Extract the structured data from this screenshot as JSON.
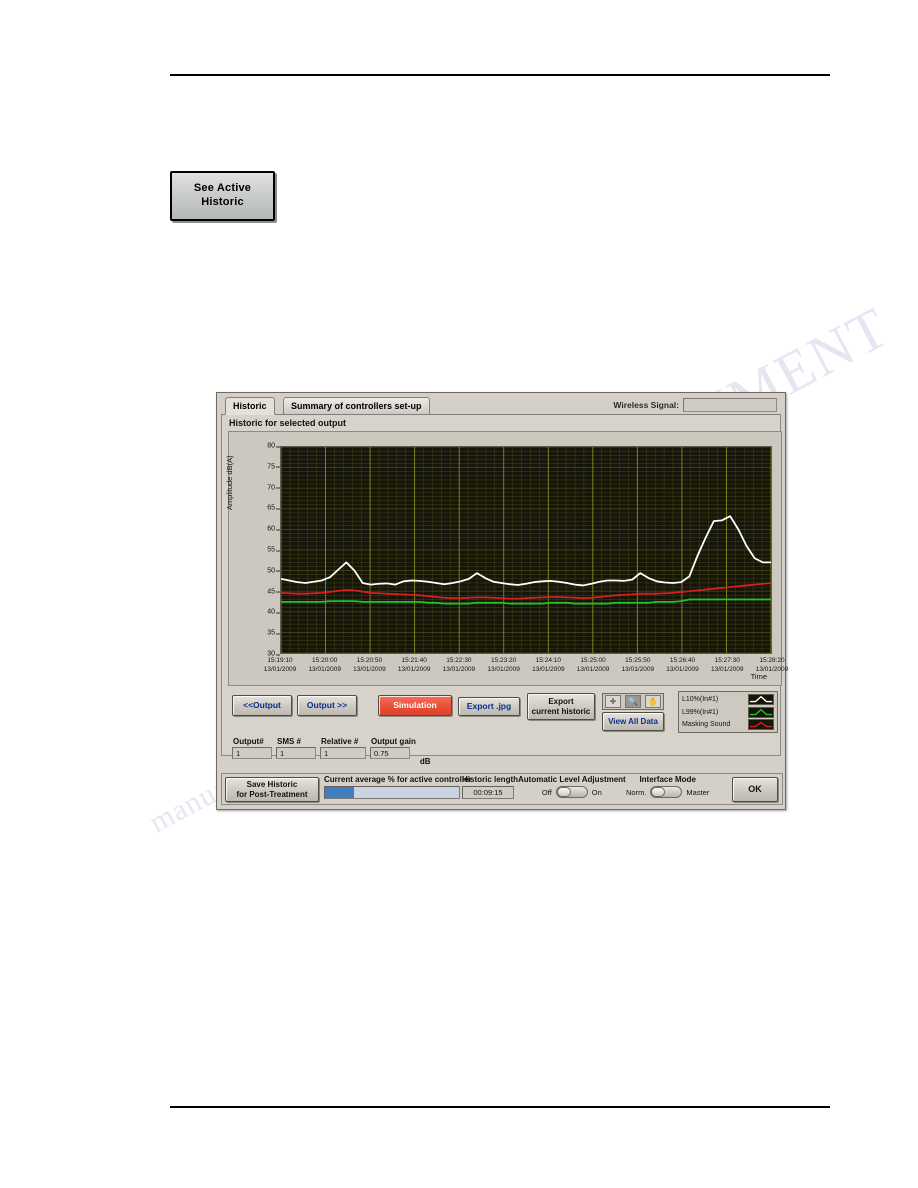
{
  "page": {
    "top_rule": true,
    "bottom_rule": true,
    "watermark_a": "DOCUMENT",
    "watermark_b": "manualslib.com",
    "watermark_c": "manuals"
  },
  "see_active_button": {
    "label": "See Active\nHistoric",
    "line1": "See Active",
    "line2": "Historic"
  },
  "panel": {
    "tabs": [
      {
        "label": "Historic",
        "active": true
      },
      {
        "label": "Summary of controllers set-up",
        "active": false
      }
    ],
    "wireless": {
      "label": "Wireless Signal:",
      "value": ""
    },
    "graph_caption": "Historic for selected output"
  },
  "chart_data": {
    "type": "line",
    "title": "Historic for selected output",
    "xlabel": "Time",
    "ylabel": "Amplitude dB(A)",
    "ylim": [
      30,
      80
    ],
    "yticks": [
      80,
      75,
      70,
      65,
      60,
      55,
      50,
      45,
      40,
      35,
      30
    ],
    "grid": true,
    "grid_color": "#6b6a1f",
    "plot_bg": "#151509",
    "legend_position": "right",
    "date": "13/01/2009",
    "xticks": [
      {
        "time": "15:19:10",
        "date": "13/01/2009"
      },
      {
        "time": "15:20:00",
        "date": "13/01/2009"
      },
      {
        "time": "15:20:50",
        "date": "13/01/2009"
      },
      {
        "time": "15:21:40",
        "date": "13/01/2009"
      },
      {
        "time": "15:22:30",
        "date": "13/01/2009"
      },
      {
        "time": "15:23:20",
        "date": "13/01/2009"
      },
      {
        "time": "15:24:10",
        "date": "13/01/2009"
      },
      {
        "time": "15:25:00",
        "date": "13/01/2009"
      },
      {
        "time": "15:25:50",
        "date": "13/01/2009"
      },
      {
        "time": "15:26:40",
        "date": "13/01/2009"
      },
      {
        "time": "15:27:30",
        "date": "13/01/2009"
      },
      {
        "time": "15:28:20",
        "date": "13/01/2009"
      }
    ],
    "x_range": [
      "15:19:10",
      "15:28:20"
    ],
    "series": [
      {
        "name": "L10%(In#1)",
        "color": "#ffffff",
        "values": [
          48.0,
          47.6,
          47.2,
          47.0,
          47.3,
          47.6,
          48.4,
          50.2,
          52.0,
          50.0,
          47.0,
          46.6,
          46.8,
          46.9,
          46.6,
          47.4,
          47.6,
          47.5,
          47.3,
          47.0,
          46.7,
          47.0,
          47.4,
          48.0,
          49.4,
          48.2,
          47.3,
          47.0,
          46.7,
          46.5,
          46.8,
          47.2,
          47.4,
          47.5,
          47.3,
          47.0,
          46.6,
          46.4,
          46.8,
          47.3,
          47.6,
          47.6,
          47.5,
          47.8,
          49.4,
          48.2,
          47.4,
          47.1,
          47.0,
          47.2,
          48.6,
          53.6,
          58.0,
          62.0,
          62.2,
          63.2,
          60.0,
          56.0,
          53.0,
          52.0,
          52.0
        ]
      },
      {
        "name": "L99%(In#1)",
        "color": "#22c322",
        "values": [
          42.4,
          42.4,
          42.4,
          42.4,
          42.4,
          42.4,
          42.6,
          42.6,
          42.6,
          42.6,
          42.4,
          42.4,
          42.4,
          42.4,
          42.4,
          42.4,
          42.4,
          42.4,
          42.2,
          42.2,
          42.0,
          42.0,
          42.0,
          42.0,
          42.2,
          42.2,
          42.2,
          42.2,
          42.0,
          42.0,
          42.0,
          42.0,
          42.0,
          42.2,
          42.2,
          42.2,
          42.0,
          42.0,
          42.0,
          42.0,
          42.0,
          42.2,
          42.2,
          42.2,
          42.2,
          42.2,
          42.4,
          42.4,
          42.4,
          42.6,
          43.0,
          43.0,
          43.0,
          43.0,
          43.0,
          43.0,
          43.0,
          43.0,
          43.0,
          43.0,
          43.0
        ]
      },
      {
        "name": "Masking Sound",
        "color": "#d61f1f",
        "values": [
          44.6,
          44.5,
          44.4,
          44.4,
          44.5,
          44.6,
          44.8,
          45.1,
          45.3,
          45.2,
          44.9,
          44.6,
          44.5,
          44.4,
          44.3,
          44.2,
          44.1,
          44.0,
          43.8,
          43.6,
          43.4,
          43.3,
          43.3,
          43.4,
          43.5,
          43.5,
          43.4,
          43.3,
          43.2,
          43.2,
          43.3,
          43.4,
          43.5,
          43.6,
          43.6,
          43.5,
          43.4,
          43.3,
          43.4,
          43.6,
          43.8,
          44.0,
          44.1,
          44.2,
          44.4,
          44.4,
          44.4,
          44.5,
          44.6,
          44.8,
          45.0,
          45.2,
          45.4,
          45.6,
          45.8,
          46.0,
          46.2,
          46.4,
          46.6,
          46.8,
          47.0
        ]
      }
    ]
  },
  "controls": {
    "prev_output": "<<Output",
    "next_output": "Output >>",
    "simulation": "Simulation",
    "export_jpg": "Export .jpg",
    "export_historic_line1": "Export",
    "export_historic_line2": "current historic",
    "view_all_data": "View All Data",
    "palette": [
      {
        "name": "cursor-tool",
        "glyph": "✛",
        "selected": false
      },
      {
        "name": "zoom-tool",
        "glyph": "🔍",
        "selected": true
      },
      {
        "name": "pan-tool",
        "glyph": "✋",
        "selected": false
      }
    ]
  },
  "fields": [
    {
      "label": "Output#",
      "value": "1"
    },
    {
      "label": "SMS #",
      "value": "1"
    },
    {
      "label": "Relative #",
      "value": "1"
    },
    {
      "label": "Output gain",
      "value": "0.75",
      "unit": "dB"
    }
  ],
  "bottom": {
    "save_historic_line1": "Save Historic",
    "save_historic_line2": "for Post-Treatment",
    "average_label": "Current average % for active controller",
    "average_percent": 22,
    "historic_length_label": "Historic length",
    "historic_length_value": "00:09:15",
    "ala_label": "Automatic Level Adjustment",
    "ala_off": "Off",
    "ala_on": "On",
    "ala_state": "off",
    "interface_label": "Interface Mode",
    "interface_left": "Norm.",
    "interface_right": "Master",
    "interface_state": "off",
    "ok": "OK"
  }
}
